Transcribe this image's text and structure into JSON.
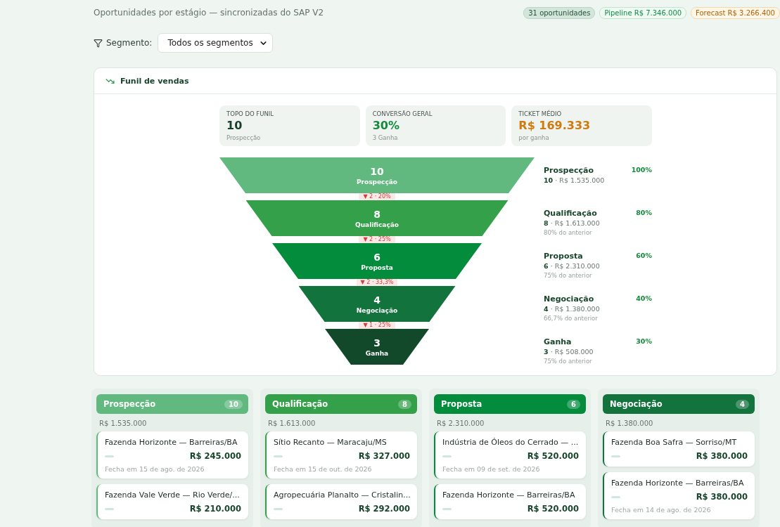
{
  "header": {
    "subtitle": "Oportunidades por estágio — sincronizadas do SAP V2",
    "badges": [
      {
        "text": "31 oportunidades",
        "kind": "neutral"
      },
      {
        "text": "Pipeline R$ 7.346.000",
        "kind": "pipeline"
      },
      {
        "text": "Forecast R$ 3.266.400",
        "kind": "forecast"
      }
    ]
  },
  "filter": {
    "label": "Segmento:",
    "value": "Todos os segmentos"
  },
  "funnel_card": {
    "title": "Funil de vendas",
    "stats": [
      {
        "label": "TOPO DO FUNIL",
        "value": "10",
        "note": "Prospecção",
        "kind": "dark"
      },
      {
        "label": "CONVERSÃO GERAL",
        "value": "30%",
        "note": "3 Ganha",
        "kind": "green"
      },
      {
        "label": "TICKET MÉDIO",
        "value": "R$ 169.333",
        "note": "por ganha",
        "kind": "orange"
      }
    ],
    "stages": [
      {
        "count": "10",
        "name": "Prospecção",
        "color": "#61b97f",
        "legend_name": "Prospecção",
        "share": "100%",
        "legend_count": "10",
        "amount": "· R$ 1.535.000"
      },
      {
        "count": "8",
        "name": "Qualificação",
        "color": "#34a049",
        "legend_name": "Qualificação",
        "share": "80%",
        "legend_count": "8",
        "amount": "· R$ 1.613.000",
        "ratio": "80% do anterior",
        "drop": "▼ 2 · 20%"
      },
      {
        "count": "6",
        "name": "Proposta",
        "color": "#028c3c",
        "legend_name": "Proposta",
        "share": "60%",
        "legend_count": "6",
        "amount": "· R$ 2.310.000",
        "ratio": "75% do anterior",
        "drop": "▼ 2 · 25%"
      },
      {
        "count": "4",
        "name": "Negociação",
        "color": "#12733c",
        "legend_name": "Negociação",
        "share": "40%",
        "legend_count": "4",
        "amount": "· R$ 1.380.000",
        "ratio": "66,7% do anterior",
        "drop": "▼ 2 · 33,3%"
      },
      {
        "count": "3",
        "name": "Ganha",
        "color": "#11492a",
        "legend_name": "Ganha",
        "share": "30%",
        "legend_count": "3",
        "amount": "· R$ 508.000",
        "ratio": "75% do anterior",
        "drop": "▼ 1 · 25%"
      }
    ]
  },
  "board": {
    "columns": [
      {
        "title": "Prospecção",
        "count": "10",
        "color": "#61b97f",
        "total": "R$ 1.535.000",
        "cards": [
          {
            "name": "Fazenda Horizonte — Barreiras/BA",
            "value": "R$ 245.000",
            "close": "Fecha em 15 de ago. de 2026"
          },
          {
            "name": "Fazenda Vale Verde — Rio Verde/...",
            "value": "R$ 210.000"
          }
        ]
      },
      {
        "title": "Qualificação",
        "count": "8",
        "color": "#34a049",
        "total": "R$ 1.613.000",
        "cards": [
          {
            "name": "Sítio Recanto — Maracaju/MS",
            "value": "R$ 327.000",
            "close": "Fecha em 15 de out. de 2026"
          },
          {
            "name": "Agropecuária Planalto — Cristalin...",
            "value": "R$ 292.000"
          }
        ]
      },
      {
        "title": "Proposta",
        "count": "6",
        "color": "#028c3c",
        "total": "R$ 2.310.000",
        "cards": [
          {
            "name": "Indústria de Óleos do Cerrado — ...",
            "value": "R$ 520.000",
            "close": "Fecha em 09 de set. de 2026"
          },
          {
            "name": "Fazenda Horizonte — Barreiras/BA",
            "value": "R$ 520.000"
          }
        ]
      },
      {
        "title": "Negociação",
        "count": "4",
        "color": "#12733c",
        "total": "R$ 1.380.000",
        "cards": [
          {
            "name": "Fazenda Boa Safra — Sorriso/MT",
            "value": "R$ 380.000"
          },
          {
            "name": "Fazenda Horizonte — Barreiras/BA",
            "value": "R$ 380.000",
            "close": "Fecha em 14 de ago. de 2026"
          }
        ]
      }
    ]
  }
}
